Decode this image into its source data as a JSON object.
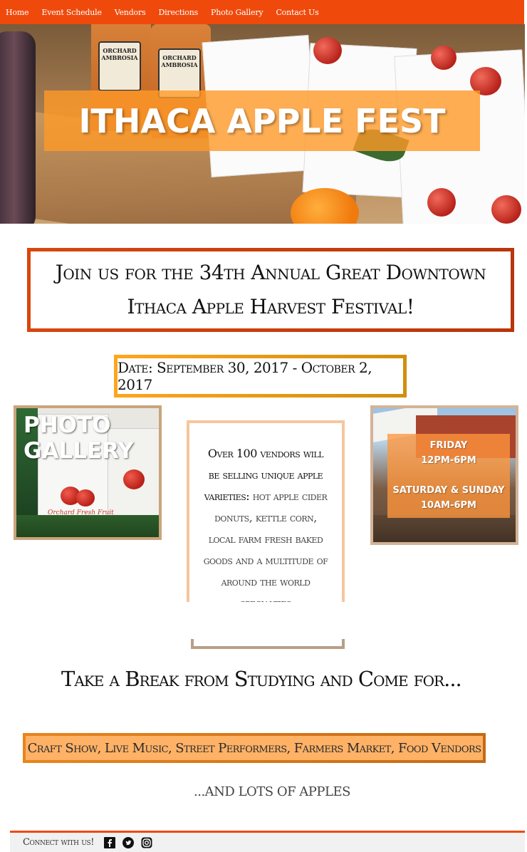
{
  "nav": {
    "items": [
      "Home",
      "Event Schedule",
      "Vendors",
      "Directions",
      "Photo Gallery",
      "Contact Us"
    ]
  },
  "hero": {
    "title": "ITHACA APPLE FEST",
    "bottle_label": "ORCHARD AMBROSIA"
  },
  "intro": {
    "text": "Join us for the 34th Annual Great Downtown Ithaca Apple Harvest Festival!"
  },
  "date": {
    "text": "Date: September 30, 2017 - October 2, 2017"
  },
  "gallery_tile": {
    "title_line1": "PHOTO",
    "title_line2": "GALLERY",
    "bag_text": "Orchard Fresh Fruit"
  },
  "vendors_box": {
    "lead": "Over 100 vendors will be selling unique apple varieties:",
    "list": "hot apple cider donuts, kettle corn, local farm fresh baked goods and a multitude of around the world specialties"
  },
  "times_tile": {
    "friday_label": "FRIDAY",
    "friday_hours": "12PM-6PM",
    "weekend_label": "SATURDAY & SUNDAY",
    "weekend_hours": "10AM-6PM"
  },
  "break_heading": "Take a Break from Studying and Come for...",
  "activities": "Craft Show, Live Music, Street Performers, Farmers Market, Food Vendors",
  "apples_line": "...AND LOTS OF APPLES",
  "footer": {
    "connect": "Connect with us!",
    "icons": [
      "facebook-icon",
      "twitter-icon",
      "instagram-icon"
    ]
  },
  "colors": {
    "brand_orange": "#ef4a0c",
    "accent_orange": "#ffb266",
    "gold": "#ffa51c"
  }
}
